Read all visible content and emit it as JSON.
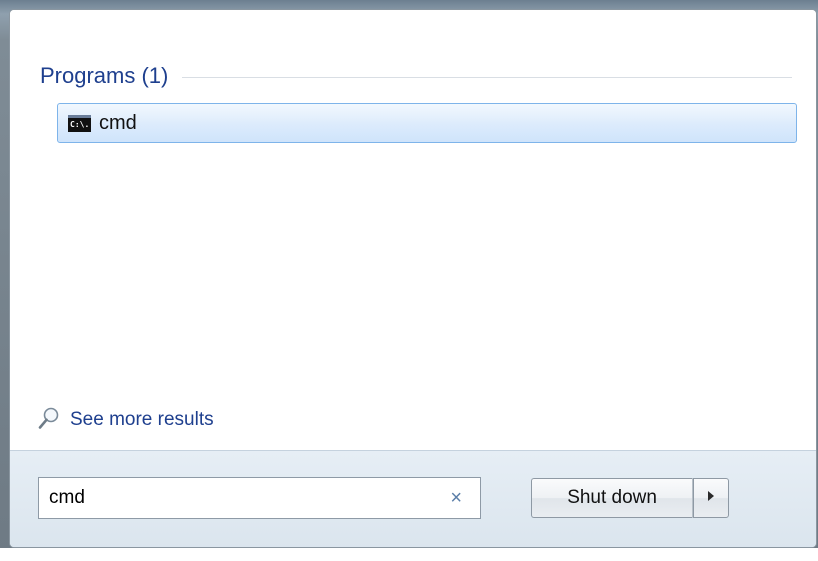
{
  "search_results": {
    "section_title": "Programs (1)",
    "items": [
      {
        "label": "cmd",
        "icon": "console-icon",
        "icon_text": "C:\\."
      }
    ],
    "see_more_label": "See more results"
  },
  "search_box": {
    "value": "cmd",
    "clear_glyph": "×"
  },
  "power": {
    "shutdown_label": "Shut down",
    "arrow_glyph": "▸"
  },
  "colors": {
    "section_title": "#1e3f8e",
    "link": "#1e3f8e",
    "selection_border": "#7eb4ea",
    "selection_fill": "#dcebfc",
    "bottom_bar": "#dbe5ee"
  }
}
